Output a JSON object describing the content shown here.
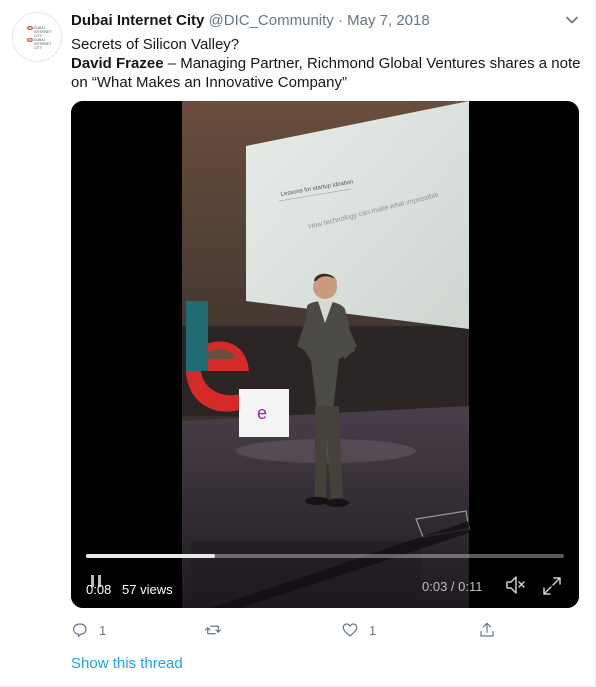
{
  "tweet": {
    "author_name": "Dubai Internet City",
    "handle": "@DIC_Community",
    "separator": "·",
    "date": "May 7, 2018",
    "text_line1": "Secrets of Silicon Valley?",
    "text_bold": "David Frazee",
    "text_rest": " – Managing Partner, Richmond Global Ventures shares a note on “What Makes an Innovative Company”"
  },
  "avatar": {
    "logo_line1": "DUBAI",
    "logo_line2": "INTERNET",
    "logo_line3": "CITY"
  },
  "video": {
    "elapsed_badge": "0:08",
    "views": "57 views",
    "time_display": "0:03 / 0:11",
    "progress": 0.27,
    "muted": true,
    "slide_heading": "Lessons for startup ideation",
    "slide_body": "How technology can make what impossible",
    "stage_logo_letter": "e"
  },
  "actions": {
    "reply_count": "1",
    "retweet_count": "",
    "like_count": "1"
  },
  "footer": {
    "show_thread": "Show this thread"
  },
  "colors": {
    "accent": "#1da1f2",
    "muted_text": "#657786",
    "stage_red": "#d52a2a"
  }
}
